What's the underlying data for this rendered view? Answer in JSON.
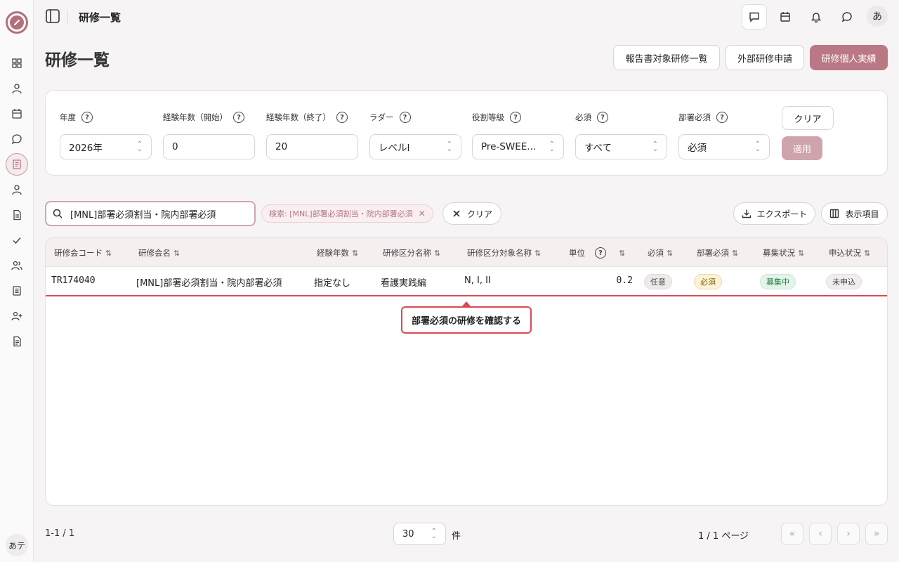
{
  "app": {
    "title": "研修一覧",
    "user_initial": "あ",
    "user_badge": "あテ"
  },
  "colors": {
    "accent": "#b97884",
    "highlight": "#d94a55"
  },
  "sidebar": {
    "items": [
      {
        "icon": "dashboard-icon"
      },
      {
        "icon": "person-icon"
      },
      {
        "icon": "calendar-icon"
      },
      {
        "icon": "chat-icon"
      },
      {
        "icon": "document-icon",
        "active": true
      },
      {
        "icon": "person-icon"
      },
      {
        "icon": "file-icon"
      },
      {
        "icon": "check-icon"
      },
      {
        "icon": "users-icon"
      },
      {
        "icon": "list-icon"
      },
      {
        "icon": "user-plus-icon"
      },
      {
        "icon": "file-text-icon"
      }
    ]
  },
  "header": {
    "page_title": "研修一覧",
    "btn_report": "報告書対象研修一覧",
    "btn_external": "外部研修申請",
    "btn_personal": "研修個人実績"
  },
  "filters": {
    "year": {
      "label": "年度",
      "value": "2026年"
    },
    "exp_start": {
      "label": "経験年数（開始）",
      "value": "0"
    },
    "exp_end": {
      "label": "経験年数（終了）",
      "value": "20"
    },
    "ladder": {
      "label": "ラダー",
      "value": "レベルI"
    },
    "role": {
      "label": "役割等級",
      "value": "Pre-SWEE..."
    },
    "required": {
      "label": "必須",
      "value": "すべて"
    },
    "dept_required": {
      "label": "部署必須",
      "value": "必須"
    },
    "clear": "クリア",
    "apply": "適用"
  },
  "search": {
    "value": "[MNL]部署必須割当・院内部署必須",
    "chip": "検索: [MNL]部署必須割当・院内部署必須",
    "clear": "クリア",
    "export": "エクスポート",
    "columns": "表示項目"
  },
  "table": {
    "headers": {
      "code": "研修会コード",
      "name": "研修会名",
      "exp": "経験年数",
      "category": "研修区分名称",
      "target": "研修区分対象名称",
      "unit": "単位",
      "required": "必須",
      "dept_required": "部署必須",
      "recruit": "募集状況",
      "apply": "申込状況"
    },
    "rows": [
      {
        "code": "TR174040",
        "name": "[MNL]部署必須割当・院内部署必須",
        "exp": "指定なし",
        "category": "看護実践編",
        "target": "N, I, II",
        "unit": "0.2",
        "required": "任意",
        "dept_required": "必須",
        "recruit": "募集中",
        "apply": "未申込"
      }
    ]
  },
  "tooltip": "部署必須の研修を確認する",
  "pagination": {
    "range": "1-1 / 1",
    "per_page": "30",
    "per_page_unit": "件",
    "page_info": "1 / 1 ページ"
  }
}
